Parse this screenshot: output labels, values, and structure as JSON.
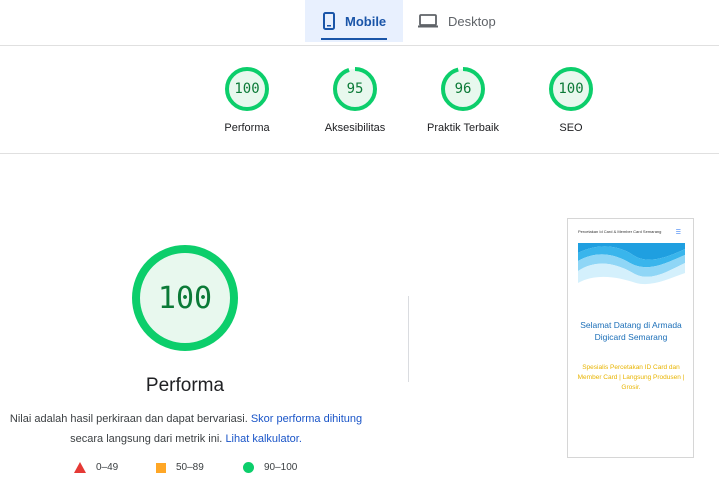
{
  "tabs": [
    {
      "label": "Mobile",
      "icon": "smartphone-icon",
      "selected": true
    },
    {
      "label": "Desktop",
      "icon": "laptop-icon",
      "selected": false
    }
  ],
  "categories": [
    {
      "score": "100",
      "label": "Performa",
      "value": 100
    },
    {
      "score": "95",
      "label": "Aksesibilitas",
      "value": 95
    },
    {
      "score": "96",
      "label": "Praktik Terbaik",
      "value": 96
    },
    {
      "score": "100",
      "label": "SEO",
      "value": 100
    }
  ],
  "main": {
    "score": "100",
    "value": 100,
    "title": "Performa",
    "desc_text1": "Nilai adalah hasil perkiraan dan dapat bervariasi.",
    "desc_link1": "Skor performa dihitung",
    "desc_text2": "secara langsung dari metrik ini.",
    "desc_link2": "Lihat kalkulator."
  },
  "legend": [
    {
      "range": "0–49",
      "shape": "triangle",
      "color": "#e53935"
    },
    {
      "range": "50–89",
      "shape": "square",
      "color": "#ffa726"
    },
    {
      "range": "90–100",
      "shape": "circle",
      "color": "#0cce6b"
    }
  ],
  "thumbnail": {
    "header": "Percetakan Id Card & Member Card Semarang",
    "welcome": "Selamat Datang di Armada Digicard Semarang",
    "tagline": "Spesialis Percetakan ID Card dan Member Card | Langsung Produsen | Grosir."
  },
  "colors": {
    "pass": "#0cce6b",
    "pass_fill": "#e8f8ee",
    "pass_text": "#0b7a37",
    "accent": "#1a55a8",
    "link": "#1a55c8"
  }
}
